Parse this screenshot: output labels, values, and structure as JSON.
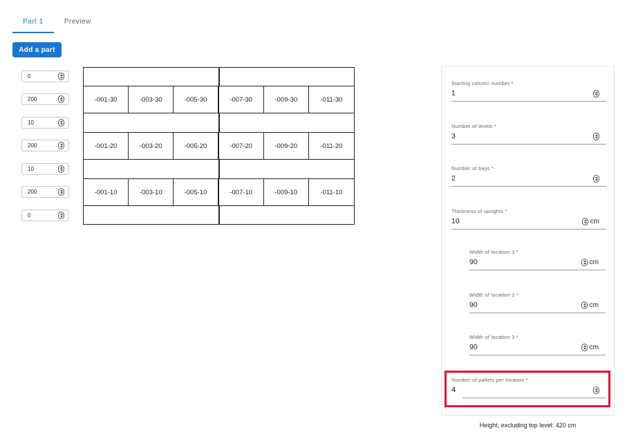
{
  "tabs": [
    {
      "label": "Part 1",
      "active": true
    },
    {
      "label": "Preview",
      "active": false
    }
  ],
  "add_part_label": "Add a part",
  "level_inputs": [
    "0",
    "200",
    "10",
    "200",
    "10",
    "200",
    "0"
  ],
  "rack": {
    "rows": [
      [
        "-001-30",
        "-003-30",
        "-005-30",
        "-007-30",
        "-009-30",
        "-011-30"
      ],
      [
        "-001-20",
        "-003-20",
        "-005-20",
        "-007-20",
        "-009-20",
        "-011-20"
      ],
      [
        "-001-10",
        "-003-10",
        "-005-10",
        "-007-10",
        "-009-10",
        "-011-10"
      ]
    ]
  },
  "form": {
    "starting_column": {
      "label": "Starting column number *",
      "value": "1"
    },
    "levels": {
      "label": "Number of levels *",
      "value": "3"
    },
    "bays": {
      "label": "Number of bays *",
      "value": "2"
    },
    "uprights": {
      "label": "Thickness of uprights *",
      "value": "10",
      "unit": "cm"
    },
    "width1": {
      "label": "Width of location 1 *",
      "value": "90",
      "unit": "cm"
    },
    "width2": {
      "label": "Width of location 2 *",
      "value": "90",
      "unit": "cm"
    },
    "width3": {
      "label": "Width of location 3 *",
      "value": "90",
      "unit": "cm"
    },
    "pallets": {
      "label": "Number of pallets per location *",
      "value": "4"
    }
  },
  "footer_note": "Height, excluding top level: 420 cm",
  "colors": {
    "accent": "#1976d2",
    "highlight": "#e0102f"
  },
  "icons": {
    "stepper": "spin-arrows-icon"
  }
}
